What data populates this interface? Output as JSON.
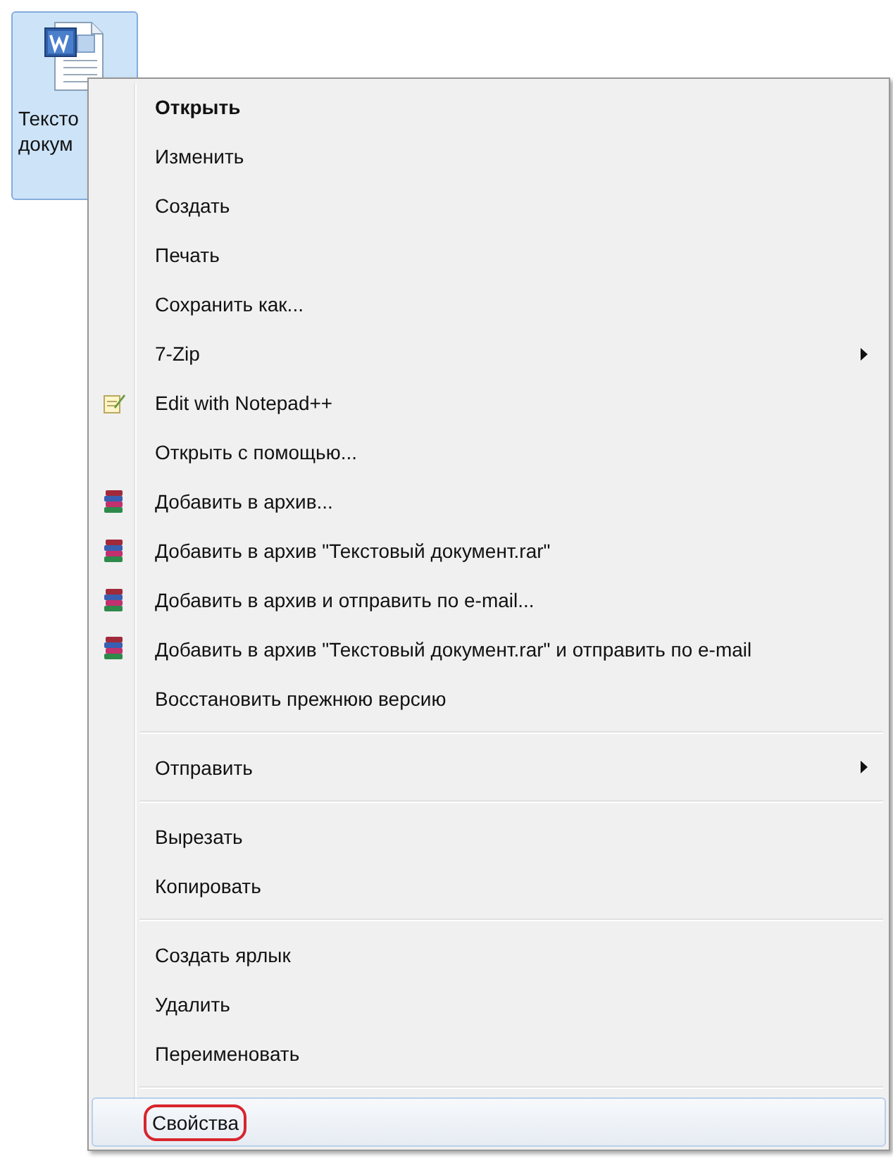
{
  "desktop_icon": {
    "label_lines": [
      "Тексто",
      "докум"
    ],
    "selected": true
  },
  "context_menu": {
    "groups": [
      [
        {
          "label": "Открыть",
          "kind": "default",
          "selected": false,
          "circled": false
        },
        {
          "label": "Изменить",
          "kind": "item",
          "selected": false,
          "circled": false
        },
        {
          "label": "Создать",
          "kind": "item",
          "selected": false,
          "circled": false
        },
        {
          "label": "Печать",
          "kind": "item",
          "selected": false,
          "circled": false
        },
        {
          "label": "Сохранить как...",
          "kind": "item",
          "selected": false,
          "circled": false
        },
        {
          "label": "7-Zip",
          "kind": "submenu",
          "selected": false,
          "circled": false
        },
        {
          "label": "Edit with Notepad++",
          "kind": "notepad",
          "selected": false,
          "circled": false
        },
        {
          "label": "Открыть с помощью...",
          "kind": "item",
          "selected": false,
          "circled": false
        },
        {
          "label": "Добавить в архив...",
          "kind": "archive",
          "selected": false,
          "circled": false
        },
        {
          "label": "Добавить в архив \"Текстовый документ.rar\"",
          "kind": "archive",
          "selected": false,
          "circled": false
        },
        {
          "label": "Добавить в архив и отправить по e-mail...",
          "kind": "archive",
          "selected": false,
          "circled": false
        },
        {
          "label": "Добавить в архив \"Текстовый документ.rar\" и отправить по e-mail",
          "kind": "archive",
          "selected": false,
          "circled": false
        },
        {
          "label": "Восстановить прежнюю версию",
          "kind": "item",
          "selected": false,
          "circled": false
        }
      ],
      [
        {
          "label": "Отправить",
          "kind": "submenu",
          "selected": false,
          "circled": false
        }
      ],
      [
        {
          "label": "Вырезать",
          "kind": "item",
          "selected": false,
          "circled": false
        },
        {
          "label": "Копировать",
          "kind": "item",
          "selected": false,
          "circled": false
        }
      ],
      [
        {
          "label": "Создать ярлык",
          "kind": "item",
          "selected": false,
          "circled": false
        },
        {
          "label": "Удалить",
          "kind": "item",
          "selected": false,
          "circled": false
        },
        {
          "label": "Переименовать",
          "kind": "item",
          "selected": false,
          "circled": false
        }
      ],
      [
        {
          "label": "Свойства",
          "kind": "item",
          "selected": true,
          "circled": true
        }
      ]
    ]
  }
}
